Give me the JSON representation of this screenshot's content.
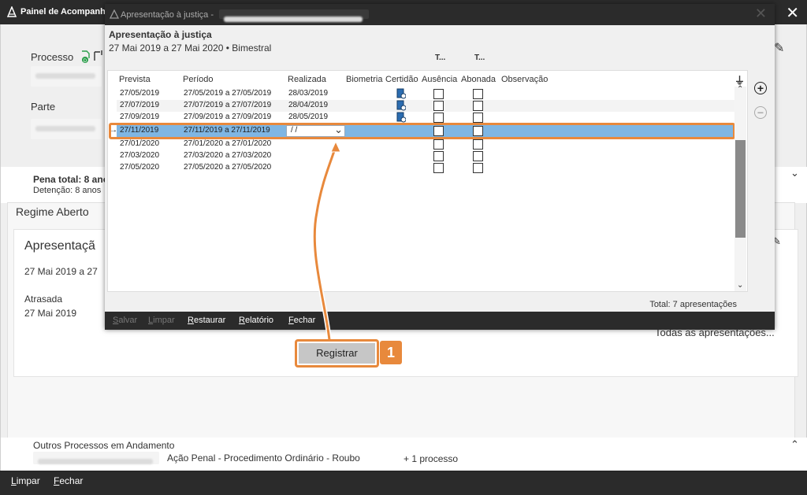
{
  "main_window": {
    "title": "Painel de Acompanh",
    "processo_label": "Processo",
    "parte_label": "Parte",
    "pena_total": "Pena total: 8 ano",
    "detencao": "Detenção: 8 anos",
    "regime_tab": "Regime Aberto",
    "apresentacao_heading": "Apresentaçã",
    "apresentacao_range": "27 Mai 2019 a 27",
    "status": "Atrasada",
    "status_date": "27 Mai 2019",
    "todas_link": "Todas as apresentações...",
    "outros_title": "Outros Processos em Andamento",
    "outros_desc": "Ação Penal - Procedimento Ordinário - Roubo",
    "outros_count": "+ 1 processo",
    "footer": {
      "limpar": "Limpar",
      "fechar": "Fechar"
    }
  },
  "dialog": {
    "title": "Apresentação à justiça -",
    "heading": "Apresentação à justiça",
    "subheading": "27 Mai 2019 a 27 Mai 2020 • Bimestral",
    "group_headers": [
      "T...",
      "T..."
    ],
    "columns": [
      "Prevista",
      "Período",
      "Realizada",
      "Biometria",
      "Certidão",
      "Ausência",
      "Abonada",
      "Observação"
    ],
    "rows": [
      {
        "prevista": "27/05/2019",
        "periodo": "27/05/2019 a 27/05/2019",
        "realizada": "28/03/2019",
        "certidao": true,
        "ausencia": false,
        "abonada": false
      },
      {
        "prevista": "27/07/2019",
        "periodo": "27/07/2019 a 27/07/2019",
        "realizada": "28/04/2019",
        "certidao": true,
        "ausencia": false,
        "abonada": false
      },
      {
        "prevista": "27/09/2019",
        "periodo": "27/09/2019 a 27/09/2019",
        "realizada": "28/05/2019",
        "certidao": true,
        "ausencia": false,
        "abonada": false
      },
      {
        "prevista": "27/11/2019",
        "periodo": "27/11/2019 a 27/11/2019",
        "realizada": " /  /",
        "certidao": false,
        "ausencia": false,
        "abonada": false,
        "selected": true
      },
      {
        "prevista": "27/01/2020",
        "periodo": "27/01/2020 a 27/01/2020",
        "realizada": "",
        "certidao": false,
        "ausencia": false,
        "abonada": false
      },
      {
        "prevista": "27/03/2020",
        "periodo": "27/03/2020 a 27/03/2020",
        "realizada": "",
        "certidao": false,
        "ausencia": false,
        "abonada": false
      },
      {
        "prevista": "27/05/2020",
        "periodo": "27/05/2020 a 27/05/2020",
        "realizada": "",
        "certidao": false,
        "ausencia": false,
        "abonada": false
      }
    ],
    "total": "Total: 7 apresentações",
    "footer": {
      "salvar": "Salvar",
      "limpar": "Limpar",
      "restaurar": "Restaurar",
      "relatorio": "Relatório",
      "fechar": "Fechar"
    }
  },
  "callout": {
    "button": "Registrar",
    "badge": "1"
  },
  "colors": {
    "accent": "#e8893c",
    "selected_row": "#7fb6e3",
    "titlebar": "#2b2b2b"
  }
}
